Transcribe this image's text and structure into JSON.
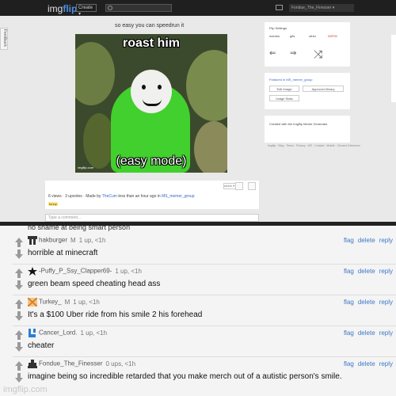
{
  "topbar": {
    "logo_prefix": "img",
    "logo_suffix": "flip",
    "create_label": "Create ▾",
    "username": "Fondue_The_Finesser ▾"
  },
  "feedback_label": "Feedback",
  "image": {
    "title": "so easy you can speedrun it",
    "top_text": "roast him",
    "bottom_text": "(easy mode)",
    "watermark": "imgflip.com",
    "stats": "6 views · 3 upvotes · Made by",
    "author": "TheCum",
    "stats_tail": "less than an hour ago in",
    "stream": "MS_memer_group",
    "tag": "funny",
    "share_label": "share ▾"
  },
  "comment_placeholder": "Type a comment...",
  "sidebar": {
    "flip_settings": "Flip Settings",
    "options": [
      "memes",
      "gifs",
      "other",
      "NSFW"
    ],
    "featured": "Featured in MS_memer_group",
    "edit_btn": "Edit Image",
    "template_btn": "Approved library",
    "share_btn": "Image Stats",
    "created_with": "Created with the Imgflip Meme Generator",
    "footer": "Imgflip · Blog · Terms · Privacy · API · Contact · Mobile · Chrome Extension"
  },
  "comments": [
    {
      "partial": "no shame at being smart person"
    },
    {
      "username": "hakburger",
      "gender": "M",
      "meta": "1 up, <1h",
      "text": "horrible at minecraft",
      "avatar_color": "#333333"
    },
    {
      "username": "-Puffy_P_Ssy_Clapper69-",
      "gender": "",
      "meta": "1 up, <1h",
      "text": "green beam speed cheating head ass",
      "avatar_color": "#111111"
    },
    {
      "username": "Turkey_",
      "gender": "M",
      "meta": "1 up, <1h",
      "text": "It's a $100 Uber ride from his smile 2 his forehead",
      "avatar_color": "#d9822b"
    },
    {
      "username": "Cancer_Lord.",
      "gender": "",
      "meta": "1 up, <1h",
      "text": "cheater",
      "avatar_color": "#2a7fd4"
    },
    {
      "username": "Fondue_The_Finesser",
      "gender": "",
      "meta": "0 ups, <1h",
      "text": "imagine being so incredible retarded that you make merch out of a autistic person's smile.",
      "avatar_color": "#333333"
    }
  ],
  "actions": {
    "flag": "flag",
    "delete": "delete",
    "reply": "reply"
  },
  "watermark": "imgflip.com"
}
